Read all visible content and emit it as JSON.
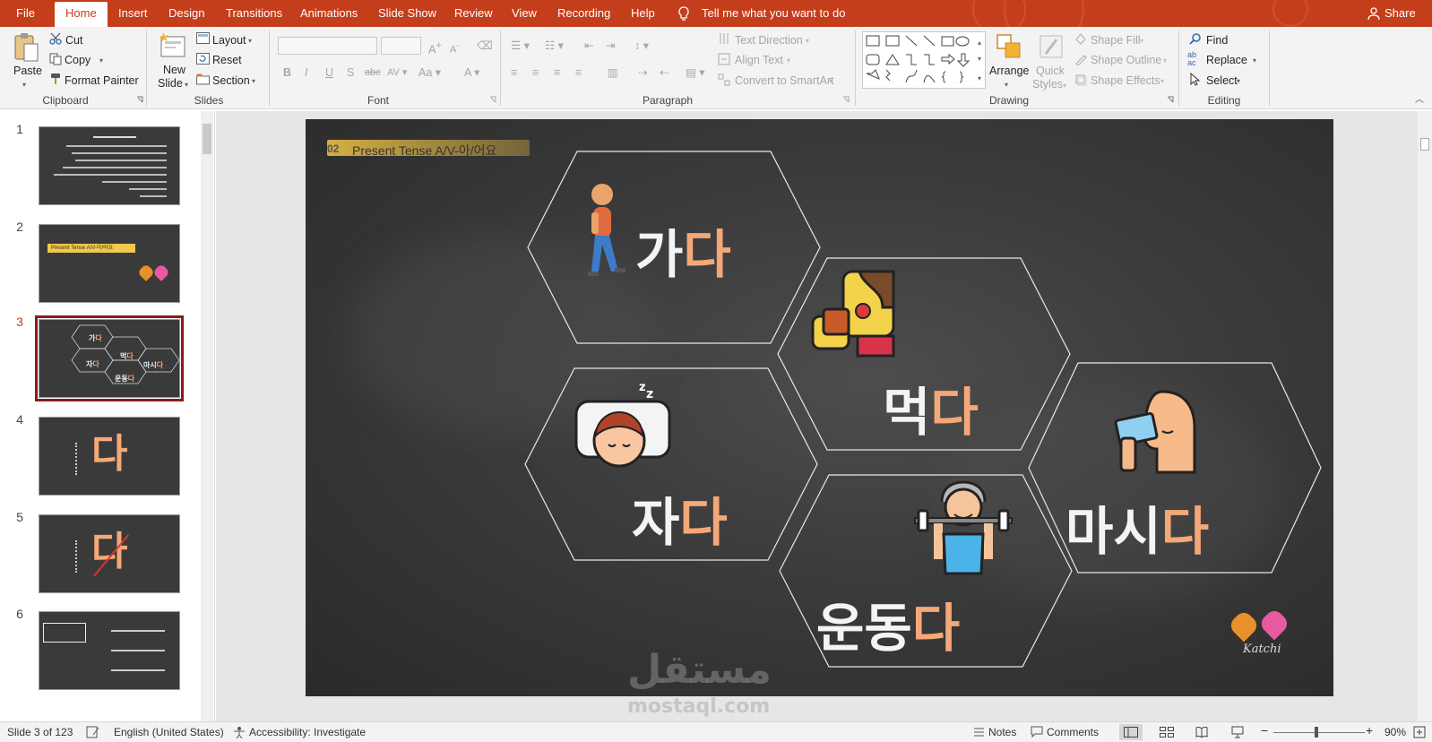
{
  "tabs": {
    "file": "File",
    "home": "Home",
    "insert": "Insert",
    "design": "Design",
    "transitions": "Transitions",
    "animations": "Animations",
    "slideshow": "Slide Show",
    "review": "Review",
    "view": "View",
    "recording": "Recording",
    "help": "Help",
    "tell_me": "Tell me what you want to do",
    "share": "Share"
  },
  "clipboard": {
    "paste": "Paste",
    "cut": "Cut",
    "copy": "Copy",
    "format_painter": "Format Painter",
    "label": "Clipboard"
  },
  "slides_group": {
    "new_slide_1": "New",
    "new_slide_2": "Slide",
    "layout": "Layout",
    "reset": "Reset",
    "section": "Section",
    "label": "Slides"
  },
  "font_group": {
    "label": "Font"
  },
  "paragraph_group": {
    "text_direction": "Text Direction",
    "align_text": "Align Text",
    "convert_smartart": "Convert to SmartArt",
    "label": "Paragraph"
  },
  "drawing_group": {
    "arrange": "Arrange",
    "quick_styles_1": "Quick",
    "quick_styles_2": "Styles",
    "shape_fill": "Shape Fill",
    "shape_outline": "Shape Outline",
    "shape_effects": "Shape Effects",
    "label": "Drawing"
  },
  "editing_group": {
    "find": "Find",
    "replace": "Replace",
    "select": "Select",
    "label": "Editing"
  },
  "thumbnails": [
    {
      "num": "1"
    },
    {
      "num": "2",
      "caption": "Present Tense A/V-아/어요"
    },
    {
      "num": "3"
    },
    {
      "num": "4"
    },
    {
      "num": "5"
    },
    {
      "num": "6"
    }
  ],
  "slide": {
    "header_num": "02",
    "header_text": "Present Tense  A/V-아/어요",
    "words": [
      {
        "base": "가",
        "ending": "다"
      },
      {
        "base": "먹",
        "ending": "다"
      },
      {
        "base": "자",
        "ending": "다"
      },
      {
        "base": "마시",
        "ending": "다"
      },
      {
        "base": "운동",
        "ending": "다"
      }
    ],
    "logo_text": "Katchi"
  },
  "watermark": {
    "arabic": "مستقل",
    "latin": "mostaql.com"
  },
  "status": {
    "slide_info": "Slide 3 of 123",
    "language": "English (United States)",
    "accessibility": "Accessibility: Investigate",
    "notes": "Notes",
    "comments": "Comments",
    "zoom": "90%"
  },
  "colors": {
    "accent": "#c43e1c",
    "selected_thumb": "#8b1a1a",
    "korean_highlight": "#f4a878",
    "slide_bg": "#3a3a3a"
  }
}
